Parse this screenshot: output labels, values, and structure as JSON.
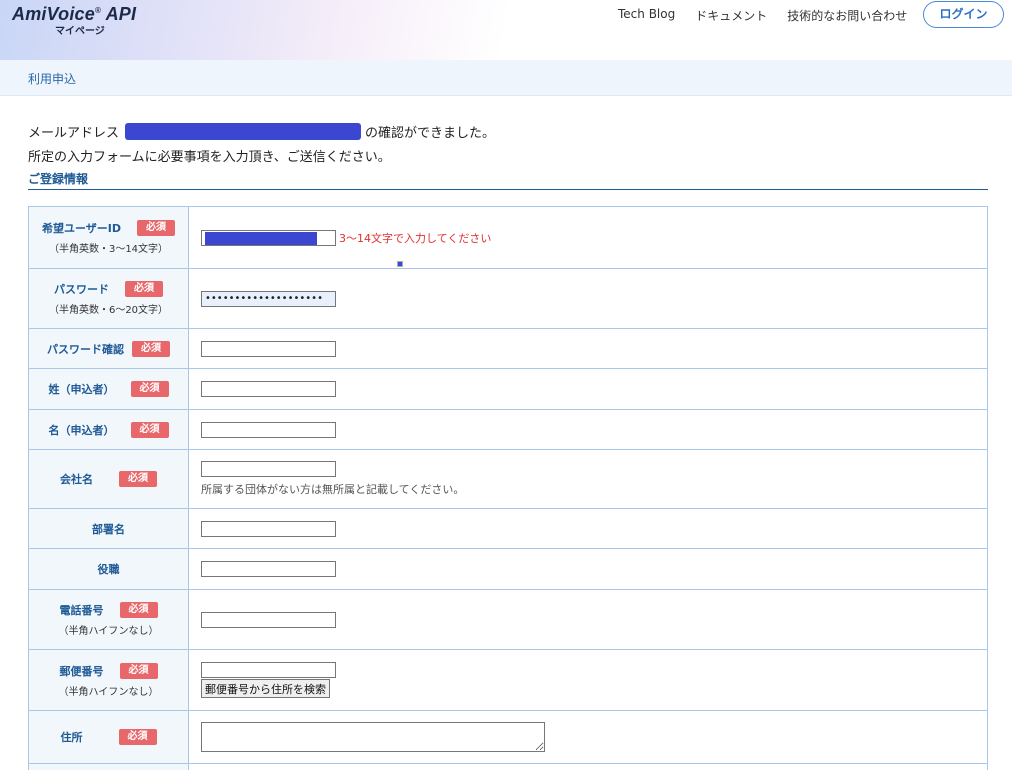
{
  "header": {
    "logo_main": "AmiVoice",
    "logo_reg": "®",
    "logo_api": " API",
    "logo_sub": "マイページ",
    "nav": [
      "Tech Blog",
      "ドキュメント",
      "技術的なお問い合わせ"
    ],
    "login_label": "ログイン"
  },
  "subbar": {
    "title": "利用申込"
  },
  "intro": {
    "line1_prefix": "メールアドレス",
    "line1_suffix": "の確認ができました。",
    "line2": "所定の入力フォームに必要事項を入力頂き、ご送信ください。"
  },
  "section_title": "ご登録情報",
  "required_label": "必須",
  "form": {
    "user_id": {
      "label": "希望ユーザーID",
      "note": "（半角英数・3〜14文字）",
      "error": "3〜14文字で入力してください"
    },
    "password": {
      "label": "パスワード",
      "note": "（半角英数・6〜20文字）",
      "value": "••••••••••••••••••••"
    },
    "password_confirm": {
      "label": "パスワード確認"
    },
    "last_name": {
      "label": "姓（申込者）"
    },
    "first_name": {
      "label": "名（申込者）"
    },
    "company": {
      "label": "会社名",
      "hint": "所属する団体がない方は無所属と記載してください。"
    },
    "department": {
      "label": "部署名"
    },
    "position": {
      "label": "役職"
    },
    "phone": {
      "label": "電話番号",
      "note": "（半角ハイフンなし）"
    },
    "postal": {
      "label": "郵便番号",
      "note": "（半角ハイフンなし）",
      "button": "郵便番号から住所を検索"
    },
    "address": {
      "label": "住所"
    }
  }
}
